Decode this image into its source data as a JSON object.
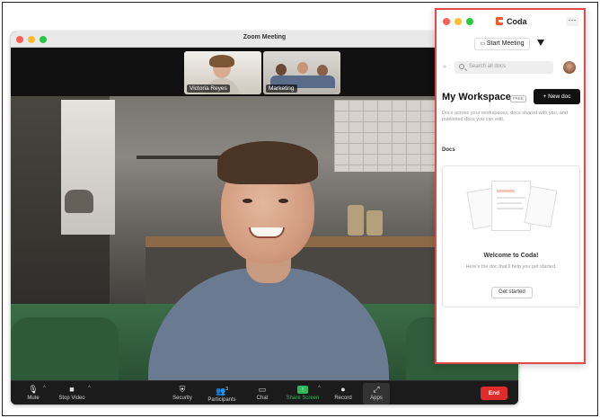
{
  "zoom": {
    "title": "Zoom Meeting",
    "participants": [
      {
        "name": "Victoria Reyes"
      },
      {
        "name": "Marketing"
      }
    ],
    "toolbar": {
      "mute": "Mute",
      "stop_video": "Stop Video",
      "security": "Security",
      "participants": "Participants",
      "participants_count": "3",
      "chat": "Chat",
      "share_screen": "Share Screen",
      "record": "Record",
      "apps": "Apps",
      "end": "End"
    }
  },
  "coda": {
    "app_name": "Coda",
    "more": "···",
    "start_meeting": "Start Meeting",
    "search_placeholder": "Search all docs",
    "workspace_title": "My Workspace",
    "plan_badge": "FREE",
    "new_doc": "+ New doc",
    "workspace_desc": "Docs across your workspaces, docs shared with you, and published docs you can edit.",
    "docs_label": "Docs",
    "welcome_title": "Welcome to Coda!",
    "welcome_desc": "Here's the doc that'll help you get started.",
    "get_started": "Get started"
  },
  "colors": {
    "coda_highlight_border": "#e04a4a",
    "coda_brand": "#f05a28",
    "zoom_share": "#2dbb5a",
    "zoom_end": "#e02b2b",
    "light_red": "#fe5f57",
    "light_yellow": "#febc2e",
    "light_green": "#28c840"
  }
}
